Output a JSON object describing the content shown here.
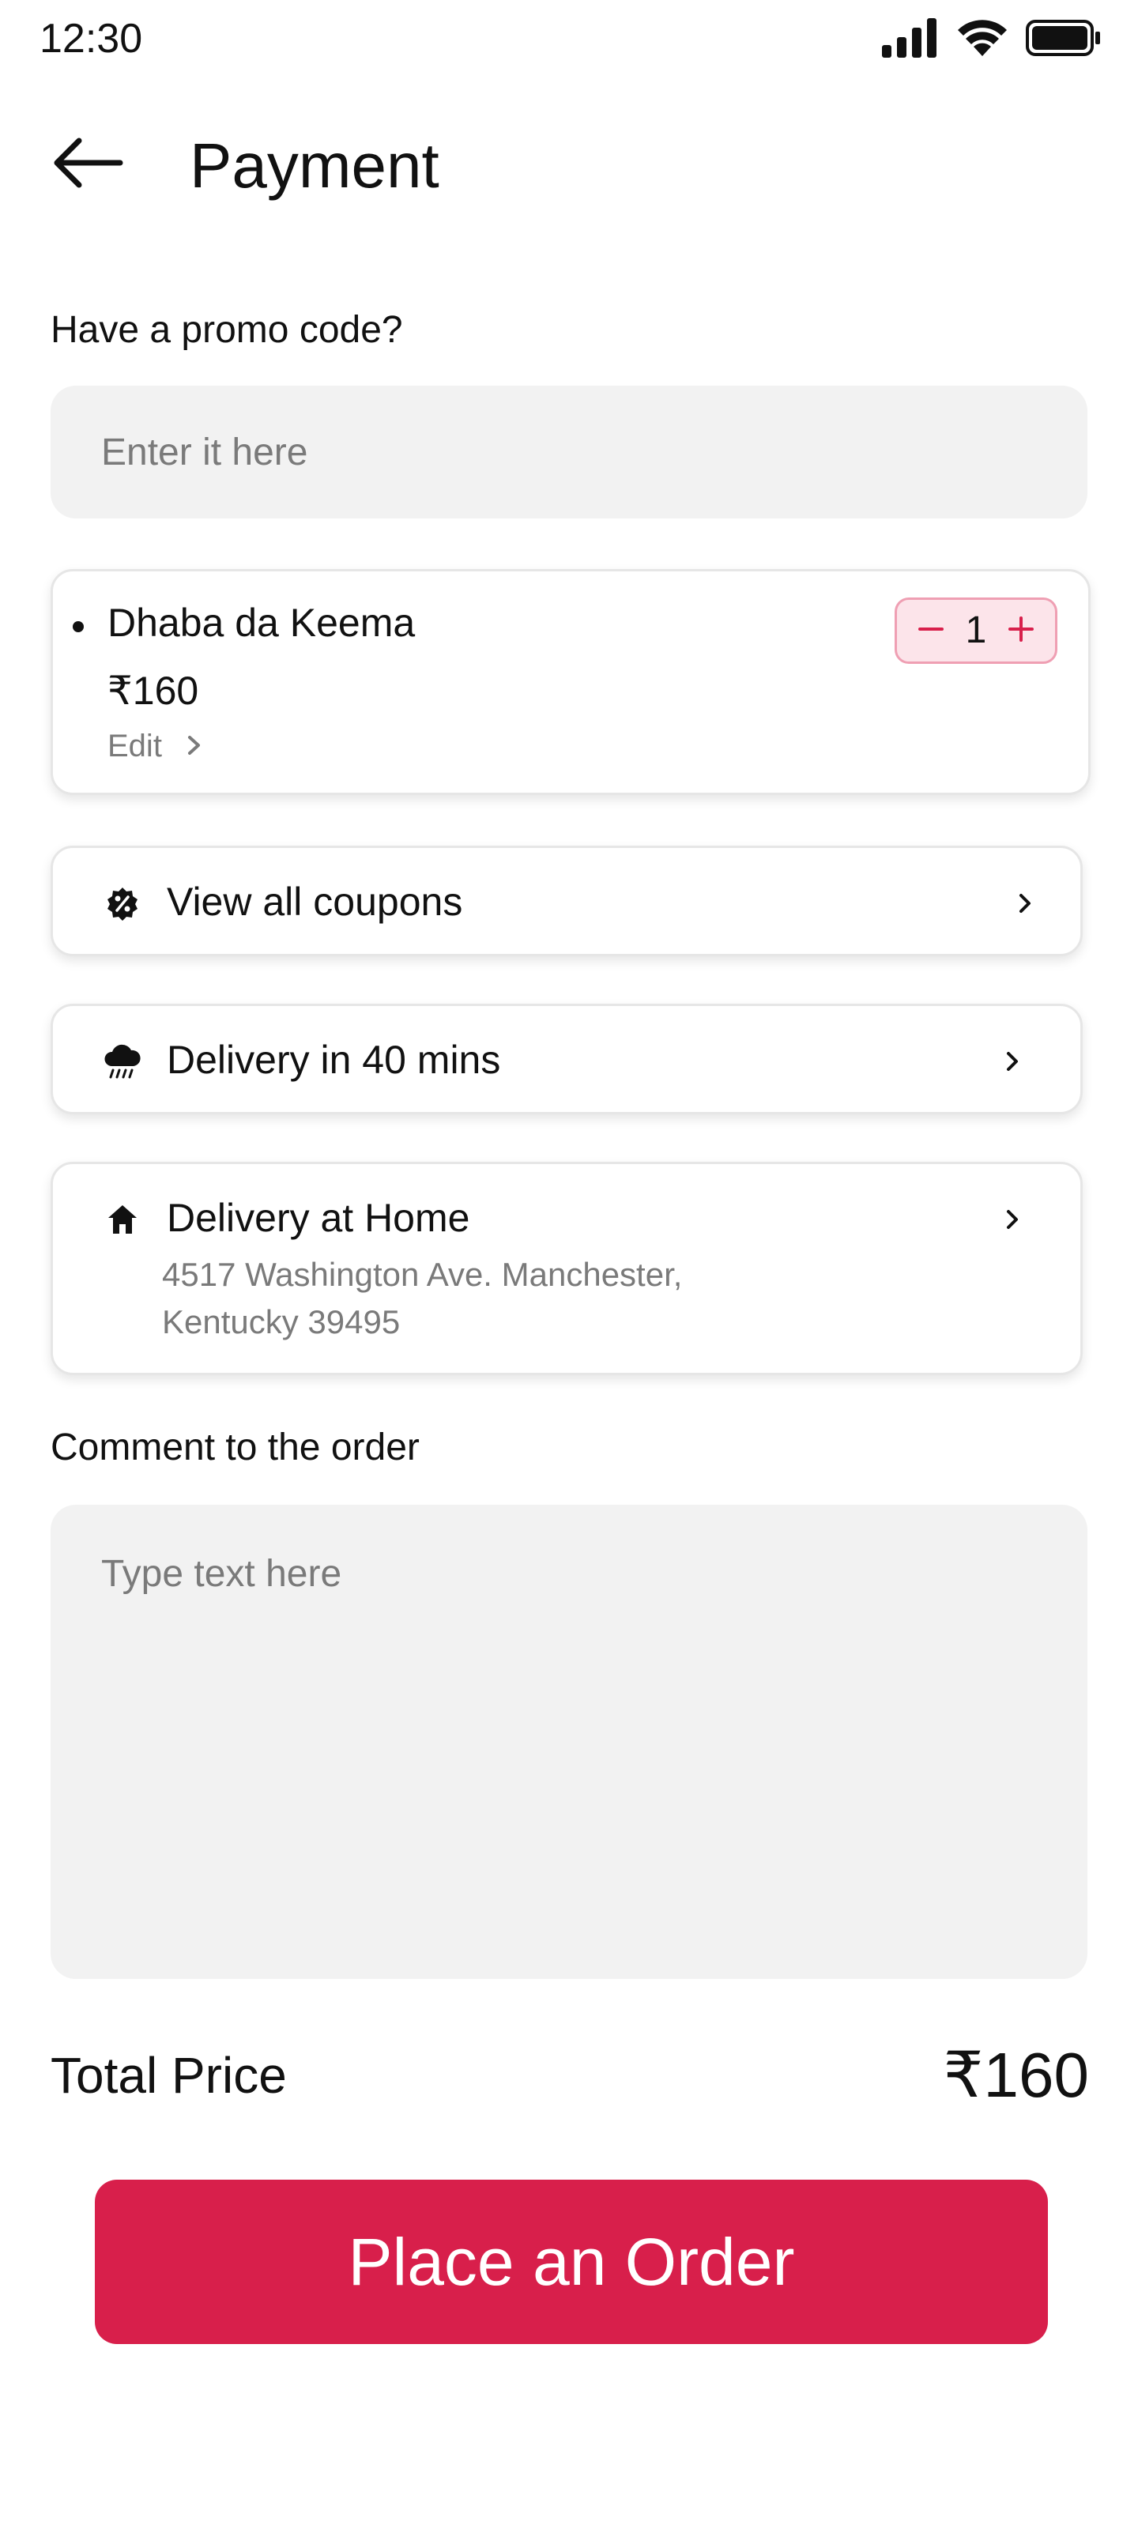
{
  "status_bar": {
    "time": "12:30",
    "icons": [
      "signal-icon",
      "wifi-icon",
      "battery-icon"
    ]
  },
  "header": {
    "back_icon": "arrow-left-icon",
    "title": "Payment"
  },
  "promo": {
    "label": "Have a promo code?",
    "placeholder": "Enter it here",
    "value": ""
  },
  "cart": {
    "items": [
      {
        "name": "Dhaba da Keema",
        "price": "₹160",
        "edit_label": "Edit",
        "quantity": "1"
      }
    ]
  },
  "options": {
    "coupons": {
      "icon": "discount-badge-icon",
      "label": "View all coupons"
    },
    "delivery_time": {
      "icon": "rain-cloud-icon",
      "label": "Delivery in 40 mins"
    },
    "delivery_address": {
      "icon": "home-icon",
      "label": "Delivery at Home",
      "address_line1": "4517 Washington Ave. Manchester,",
      "address_line2": "Kentucky 39495"
    }
  },
  "comment": {
    "label": "Comment to the order",
    "placeholder": "Type text here",
    "value": ""
  },
  "total": {
    "label": "Total Price",
    "value": "₹160"
  },
  "order_button": {
    "label": "Place an Order"
  },
  "colors": {
    "accent": "#d81f4b",
    "stepper_bg": "#fce4ea",
    "stepper_border": "#ef9fb3",
    "input_bg": "#f2f2f2",
    "muted_text": "#7a7a7a"
  }
}
